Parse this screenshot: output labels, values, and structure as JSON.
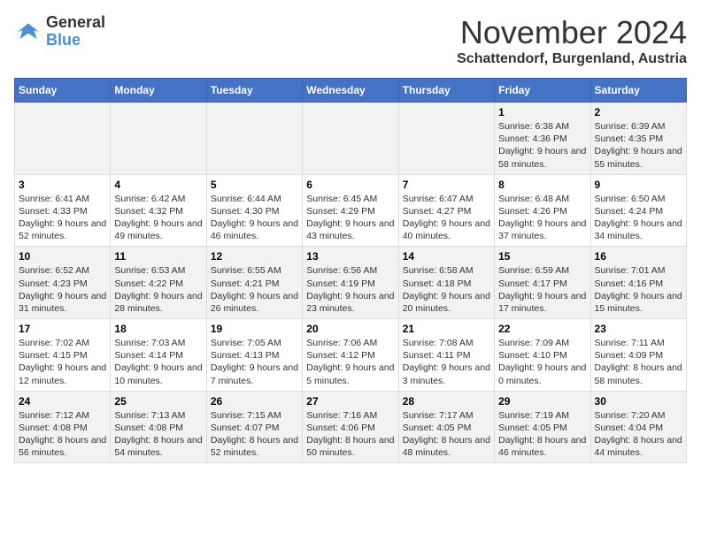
{
  "logo": {
    "line1": "General",
    "line2": "Blue"
  },
  "title": "November 2024",
  "subtitle": "Schattendorf, Burgenland, Austria",
  "weekdays": [
    "Sunday",
    "Monday",
    "Tuesday",
    "Wednesday",
    "Thursday",
    "Friday",
    "Saturday"
  ],
  "weeks": [
    [
      {
        "day": "",
        "info": ""
      },
      {
        "day": "",
        "info": ""
      },
      {
        "day": "",
        "info": ""
      },
      {
        "day": "",
        "info": ""
      },
      {
        "day": "",
        "info": ""
      },
      {
        "day": "1",
        "info": "Sunrise: 6:38 AM\nSunset: 4:36 PM\nDaylight: 9 hours and 58 minutes."
      },
      {
        "day": "2",
        "info": "Sunrise: 6:39 AM\nSunset: 4:35 PM\nDaylight: 9 hours and 55 minutes."
      }
    ],
    [
      {
        "day": "3",
        "info": "Sunrise: 6:41 AM\nSunset: 4:33 PM\nDaylight: 9 hours and 52 minutes."
      },
      {
        "day": "4",
        "info": "Sunrise: 6:42 AM\nSunset: 4:32 PM\nDaylight: 9 hours and 49 minutes."
      },
      {
        "day": "5",
        "info": "Sunrise: 6:44 AM\nSunset: 4:30 PM\nDaylight: 9 hours and 46 minutes."
      },
      {
        "day": "6",
        "info": "Sunrise: 6:45 AM\nSunset: 4:29 PM\nDaylight: 9 hours and 43 minutes."
      },
      {
        "day": "7",
        "info": "Sunrise: 6:47 AM\nSunset: 4:27 PM\nDaylight: 9 hours and 40 minutes."
      },
      {
        "day": "8",
        "info": "Sunrise: 6:48 AM\nSunset: 4:26 PM\nDaylight: 9 hours and 37 minutes."
      },
      {
        "day": "9",
        "info": "Sunrise: 6:50 AM\nSunset: 4:24 PM\nDaylight: 9 hours and 34 minutes."
      }
    ],
    [
      {
        "day": "10",
        "info": "Sunrise: 6:52 AM\nSunset: 4:23 PM\nDaylight: 9 hours and 31 minutes."
      },
      {
        "day": "11",
        "info": "Sunrise: 6:53 AM\nSunset: 4:22 PM\nDaylight: 9 hours and 28 minutes."
      },
      {
        "day": "12",
        "info": "Sunrise: 6:55 AM\nSunset: 4:21 PM\nDaylight: 9 hours and 26 minutes."
      },
      {
        "day": "13",
        "info": "Sunrise: 6:56 AM\nSunset: 4:19 PM\nDaylight: 9 hours and 23 minutes."
      },
      {
        "day": "14",
        "info": "Sunrise: 6:58 AM\nSunset: 4:18 PM\nDaylight: 9 hours and 20 minutes."
      },
      {
        "day": "15",
        "info": "Sunrise: 6:59 AM\nSunset: 4:17 PM\nDaylight: 9 hours and 17 minutes."
      },
      {
        "day": "16",
        "info": "Sunrise: 7:01 AM\nSunset: 4:16 PM\nDaylight: 9 hours and 15 minutes."
      }
    ],
    [
      {
        "day": "17",
        "info": "Sunrise: 7:02 AM\nSunset: 4:15 PM\nDaylight: 9 hours and 12 minutes."
      },
      {
        "day": "18",
        "info": "Sunrise: 7:03 AM\nSunset: 4:14 PM\nDaylight: 9 hours and 10 minutes."
      },
      {
        "day": "19",
        "info": "Sunrise: 7:05 AM\nSunset: 4:13 PM\nDaylight: 9 hours and 7 minutes."
      },
      {
        "day": "20",
        "info": "Sunrise: 7:06 AM\nSunset: 4:12 PM\nDaylight: 9 hours and 5 minutes."
      },
      {
        "day": "21",
        "info": "Sunrise: 7:08 AM\nSunset: 4:11 PM\nDaylight: 9 hours and 3 minutes."
      },
      {
        "day": "22",
        "info": "Sunrise: 7:09 AM\nSunset: 4:10 PM\nDaylight: 9 hours and 0 minutes."
      },
      {
        "day": "23",
        "info": "Sunrise: 7:11 AM\nSunset: 4:09 PM\nDaylight: 8 hours and 58 minutes."
      }
    ],
    [
      {
        "day": "24",
        "info": "Sunrise: 7:12 AM\nSunset: 4:08 PM\nDaylight: 8 hours and 56 minutes."
      },
      {
        "day": "25",
        "info": "Sunrise: 7:13 AM\nSunset: 4:08 PM\nDaylight: 8 hours and 54 minutes."
      },
      {
        "day": "26",
        "info": "Sunrise: 7:15 AM\nSunset: 4:07 PM\nDaylight: 8 hours and 52 minutes."
      },
      {
        "day": "27",
        "info": "Sunrise: 7:16 AM\nSunset: 4:06 PM\nDaylight: 8 hours and 50 minutes."
      },
      {
        "day": "28",
        "info": "Sunrise: 7:17 AM\nSunset: 4:05 PM\nDaylight: 8 hours and 48 minutes."
      },
      {
        "day": "29",
        "info": "Sunrise: 7:19 AM\nSunset: 4:05 PM\nDaylight: 8 hours and 46 minutes."
      },
      {
        "day": "30",
        "info": "Sunrise: 7:20 AM\nSunset: 4:04 PM\nDaylight: 8 hours and 44 minutes."
      }
    ]
  ]
}
